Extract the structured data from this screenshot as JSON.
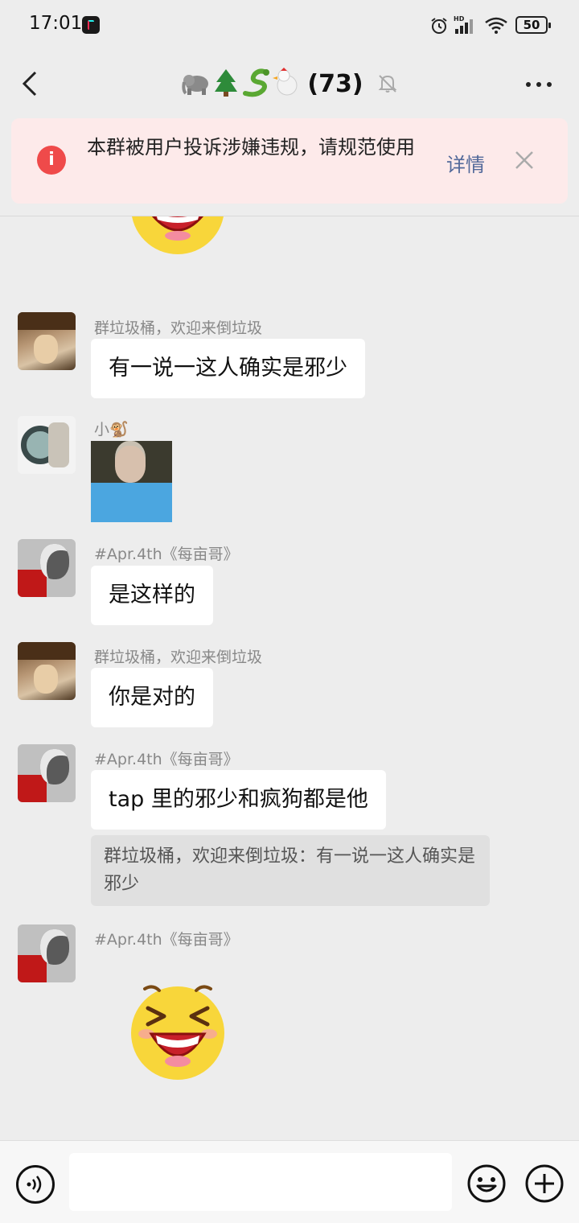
{
  "status_bar": {
    "time": "17:01",
    "battery": "50",
    "icons": [
      "tiktok-app-icon",
      "alarm-icon",
      "hd-signal-icon",
      "wifi-icon",
      "battery-icon"
    ]
  },
  "header": {
    "title_emoji": "🐘🌲🐍🐔",
    "title_count": "(73)",
    "icons": [
      "back-arrow-icon",
      "mute-bell-icon",
      "more-dots-icon"
    ]
  },
  "notice": {
    "text": "本群被用户投诉涉嫌违规，请规范使用",
    "detail_label": "详情",
    "accent_color": "#ef4a4a",
    "link_color": "#52699a"
  },
  "messages": [
    {
      "type": "sticker",
      "description": "laughing-emoji"
    },
    {
      "sender": "群垃圾桶，欢迎来倒垃圾",
      "text": "有一说一这人确实是邪少"
    },
    {
      "sender": "小🐒",
      "type": "image"
    },
    {
      "sender": "#Apr.4th《每亩哥》",
      "text": "是这样的"
    },
    {
      "sender": "群垃圾桶，欢迎来倒垃圾",
      "text": "你是对的"
    },
    {
      "sender": "#Apr.4th《每亩哥》",
      "text": "tap 里的邪少和疯狗都是他",
      "quote": "群垃圾桶，欢迎来倒垃圾：有一说一这人确实是邪少"
    },
    {
      "sender": "#Apr.4th《每亩哥》",
      "type": "sticker",
      "description": "laughing-emoji"
    }
  ],
  "input_bar": {
    "placeholder": "",
    "icons": [
      "voice-icon",
      "emoji-icon",
      "plus-icon"
    ]
  }
}
